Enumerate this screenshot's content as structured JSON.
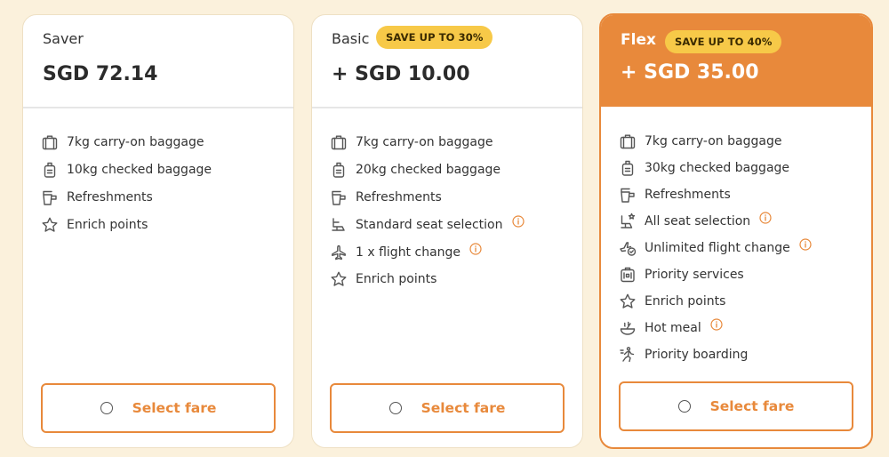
{
  "colors": {
    "accent": "#e8893b",
    "badge": "#f7c948",
    "background": "#fbf1dc"
  },
  "fares": [
    {
      "name": "Saver",
      "badge": "",
      "price": "SGD 72.14",
      "features": [
        {
          "icon": "carry-on-icon",
          "label": "7kg carry-on baggage"
        },
        {
          "icon": "checked-bag-icon",
          "label": "10kg checked baggage"
        },
        {
          "icon": "refreshments-icon",
          "label": "Refreshments"
        },
        {
          "icon": "star-icon",
          "label": "Enrich points"
        }
      ],
      "button_label": "Select fare"
    },
    {
      "name": "Basic",
      "badge": "SAVE UP TO 30%",
      "price": "+ SGD 10.00",
      "features": [
        {
          "icon": "carry-on-icon",
          "label": "7kg carry-on baggage"
        },
        {
          "icon": "checked-bag-icon",
          "label": "20kg checked baggage"
        },
        {
          "icon": "refreshments-icon",
          "label": "Refreshments"
        },
        {
          "icon": "seat-icon",
          "label": "Standard seat selection",
          "info": true
        },
        {
          "icon": "plane-icon",
          "label": "1 x flight change",
          "info": true
        },
        {
          "icon": "star-icon",
          "label": "Enrich points"
        }
      ],
      "button_label": "Select fare"
    },
    {
      "name": "Flex",
      "badge": "SAVE UP TO 40%",
      "price": "+ SGD 35.00",
      "features": [
        {
          "icon": "carry-on-icon",
          "label": "7kg carry-on baggage"
        },
        {
          "icon": "checked-bag-icon",
          "label": "30kg checked baggage"
        },
        {
          "icon": "refreshments-icon",
          "label": "Refreshments"
        },
        {
          "icon": "seat-star-icon",
          "label": "All seat selection",
          "info": true
        },
        {
          "icon": "plane-check-icon",
          "label": "Unlimited flight change",
          "info": true
        },
        {
          "icon": "priority-services-icon",
          "label": "Priority services"
        },
        {
          "icon": "star-icon",
          "label": "Enrich points"
        },
        {
          "icon": "hot-meal-icon",
          "label": "Hot meal",
          "info": true
        },
        {
          "icon": "priority-boarding-icon",
          "label": "Priority boarding"
        }
      ],
      "button_label": "Select fare"
    }
  ]
}
